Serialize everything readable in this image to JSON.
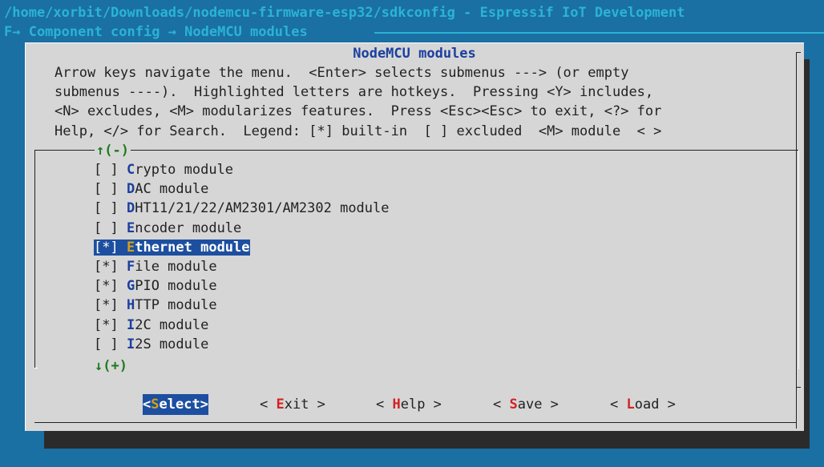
{
  "window": {
    "title": "/home/xorbit/Downloads/nodemcu-firmware-esp32/sdkconfig - Espressif IoT Development",
    "breadcrumb": "F→ Component config → NodeMCU modules "
  },
  "dialog": {
    "title": "NodeMCU modules",
    "help_lines": [
      "Arrow keys navigate the menu.  <Enter> selects submenus ---> (or empty",
      "submenus ----).  Highlighted letters are hotkeys.  Pressing <Y> includes,",
      "<N> excludes, <M> modularizes features.  Press <Esc><Esc> to exit, <?> for",
      "Help, </> for Search.  Legend: [*] built-in  [ ] excluded  <M> module  < >"
    ],
    "scroll_up": "↑(-)",
    "scroll_down": "↓(+)"
  },
  "menu": {
    "items": [
      {
        "mark": "[ ]",
        "hot": "C",
        "rest": "rypto module"
      },
      {
        "mark": "[ ]",
        "hot": "D",
        "rest": "AC module"
      },
      {
        "mark": "[ ]",
        "hot": "D",
        "rest": "HT11/21/22/AM2301/AM2302 module"
      },
      {
        "mark": "[ ]",
        "hot": "E",
        "rest": "ncoder module"
      },
      {
        "mark": "[*]",
        "hot": "E",
        "rest": "thernet module"
      },
      {
        "mark": "[*]",
        "hot": "F",
        "rest": "ile module"
      },
      {
        "mark": "[*]",
        "hot": "G",
        "rest": "PIO module"
      },
      {
        "mark": "[*]",
        "hot": "H",
        "rest": "TTP module"
      },
      {
        "mark": "[*]",
        "hot": "I",
        "rest": "2C module"
      },
      {
        "mark": "[ ]",
        "hot": "I",
        "rest": "2S module"
      }
    ],
    "selected_index": 4
  },
  "buttons": {
    "select": {
      "pre": "<",
      "hot": "S",
      "rest": "elect>"
    },
    "exit": {
      "pre": "< ",
      "hot": "E",
      "rest": "xit >"
    },
    "help": {
      "pre": "< ",
      "hot": "H",
      "rest": "elp >"
    },
    "save": {
      "pre": "< ",
      "hot": "S",
      "rest": "ave >"
    },
    "load": {
      "pre": "< ",
      "hot": "L",
      "rest": "oad >"
    }
  }
}
